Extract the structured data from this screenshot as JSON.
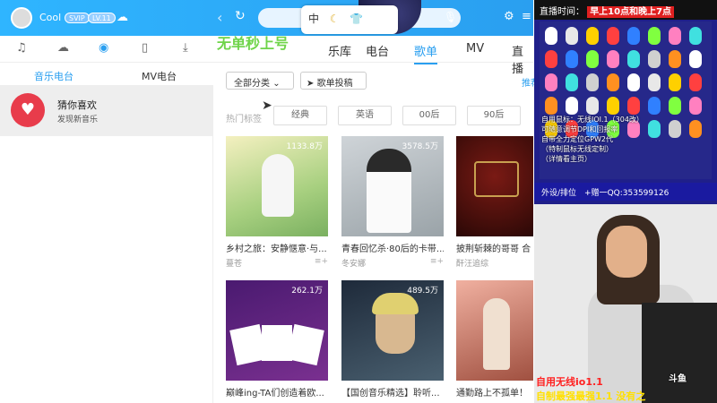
{
  "topbar": {
    "username": "Cool",
    "svip": "SVIP",
    "level": "LV.11"
  },
  "overlay": {
    "widget_text": "中"
  },
  "watermark": "无单秒上号",
  "sidebar": {
    "subtabs": [
      "音乐电台",
      "MV电台"
    ],
    "radio_title": "猜你喜欢",
    "radio_sub": "发现新音乐"
  },
  "main": {
    "tabs": [
      "乐库",
      "电台",
      "歌单",
      "MV",
      "直播"
    ],
    "category": "全部分类",
    "submit": "歌单投稿",
    "recommend": "推荐",
    "hot_label": "热门标签",
    "tags": [
      "经典",
      "英语",
      "00后",
      "90后"
    ]
  },
  "cards": [
    {
      "plays": "1133.8万",
      "title": "乡村之旅：安静惬意·与...",
      "author": "蔓苍"
    },
    {
      "plays": "3578.5万",
      "title": "青春回忆杀·80后的卡带...",
      "author": "冬安娜"
    },
    {
      "plays": "",
      "title": "披荆斩棘的哥哥 合",
      "author": "酐汪追综"
    },
    {
      "plays": "262.1万",
      "title": "巅峰ing-TA们创造着欧...",
      "author": ""
    },
    {
      "plays": "489.5万",
      "title": "【国创音乐精选】聆听...",
      "author": ""
    },
    {
      "plays": "",
      "title": "通勤路上不孤单！",
      "author": ""
    }
  ],
  "stream": {
    "banner_label": "直播时间：",
    "banner_time": "早上10点和晚上7点",
    "promo1": "自用鼠标：无线IOI.1（304改）",
    "promo2": "可随意调节DPI和回报率",
    "promo3": "自带全力定位GPW2代",
    "promo4": "（特制鼠标无线定制）",
    "promo5": "（详情看主页）",
    "qq": "外设/排位　+赠一QQ:353599126",
    "cam_text1": "自用无线io1.1",
    "cam_text2": "自制最强最强1.1 没有之",
    "logo": "斗鱼"
  }
}
